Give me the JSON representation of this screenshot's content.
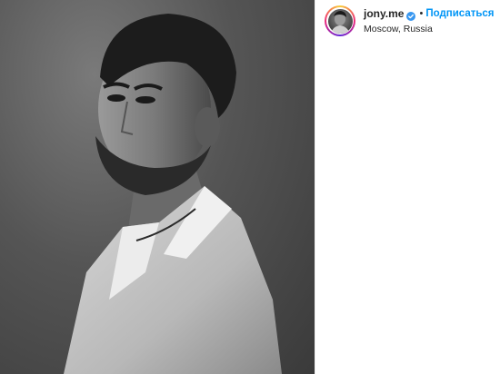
{
  "post": {
    "image_alt": "",
    "username": "jony.me",
    "verified": true,
    "separator": "•",
    "follow_label": "Подписаться",
    "location": "Moscow, Russia"
  },
  "icons": {
    "verified_badge": "verified-badge-icon"
  },
  "colors": {
    "follow": "#0095f6",
    "verified": "#3897f0",
    "username": "#262626"
  }
}
